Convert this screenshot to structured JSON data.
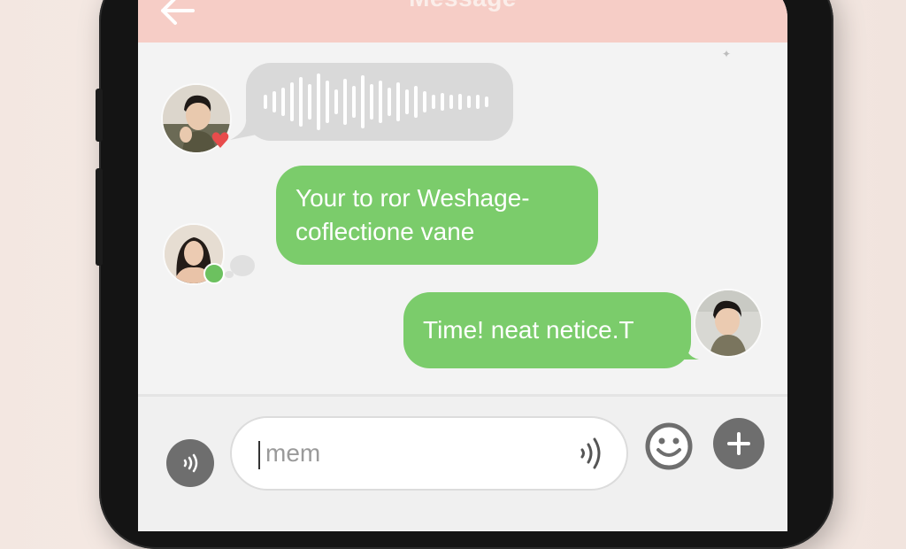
{
  "header": {
    "title": "Message",
    "back_icon": "arrow-left-icon"
  },
  "messages": [
    {
      "type": "voice",
      "sender": "contact",
      "avatar_badge": "heart-icon"
    },
    {
      "type": "text",
      "sender": "contact-2",
      "text_line1": "Your to ror Weshage-",
      "text_line2": "coflectione vane"
    },
    {
      "type": "text",
      "sender": "me",
      "text": "Time! neat netice.T"
    }
  ],
  "composer": {
    "value": "mem",
    "left_button_icon": "voice-wave-icon",
    "field_voice_icon": "voice-wave-icon",
    "emoji_icon": "smiley-icon",
    "add_icon": "plus-icon"
  },
  "colors": {
    "header": "#f6cdc6",
    "bubble_green": "#7bcc6b",
    "bubble_grey": "#d9d9d9",
    "button_grey": "#6e6e6e",
    "heart": "#e84c4c",
    "online": "#6cc15f"
  }
}
